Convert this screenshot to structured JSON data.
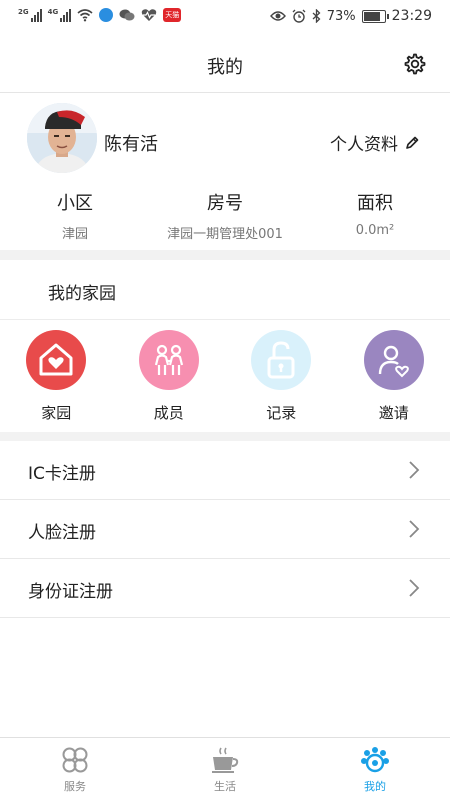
{
  "status_bar": {
    "net_1": "2G",
    "net_2": "4G",
    "app_badge": "天猫",
    "battery": "73%",
    "time": "23:29"
  },
  "header": {
    "title": "我的",
    "settings_icon": "gear-icon"
  },
  "profile": {
    "name": "陈有活",
    "edit_label": "个人资料",
    "edit_icon": "pencil-icon",
    "stats": [
      {
        "label": "小区",
        "value": "津园"
      },
      {
        "label": "房号",
        "value": "津园一期管理处001"
      },
      {
        "label": "面积",
        "value": "0.0m²"
      }
    ]
  },
  "home": {
    "title": "我的家园",
    "shortcuts": [
      {
        "label": "家园",
        "icon": "home-heart-icon",
        "color": "#e84b4b"
      },
      {
        "label": "成员",
        "icon": "family-icon",
        "color": "#f78fb0"
      },
      {
        "label": "记录",
        "icon": "unlock-icon",
        "color": "#d9f1fb"
      },
      {
        "label": "邀请",
        "icon": "invite-user-icon",
        "color": "#9a86c0"
      }
    ]
  },
  "menu": [
    {
      "label": "IC卡注册"
    },
    {
      "label": "人脸注册"
    },
    {
      "label": "身份证注册"
    }
  ],
  "tabbar": {
    "active_color": "#1aa0e6",
    "items": [
      {
        "label": "服务",
        "icon": "clover-icon",
        "active": false
      },
      {
        "label": "生活",
        "icon": "coffee-cup-icon",
        "active": false
      },
      {
        "label": "我的",
        "icon": "user-flower-icon",
        "active": true
      }
    ]
  }
}
